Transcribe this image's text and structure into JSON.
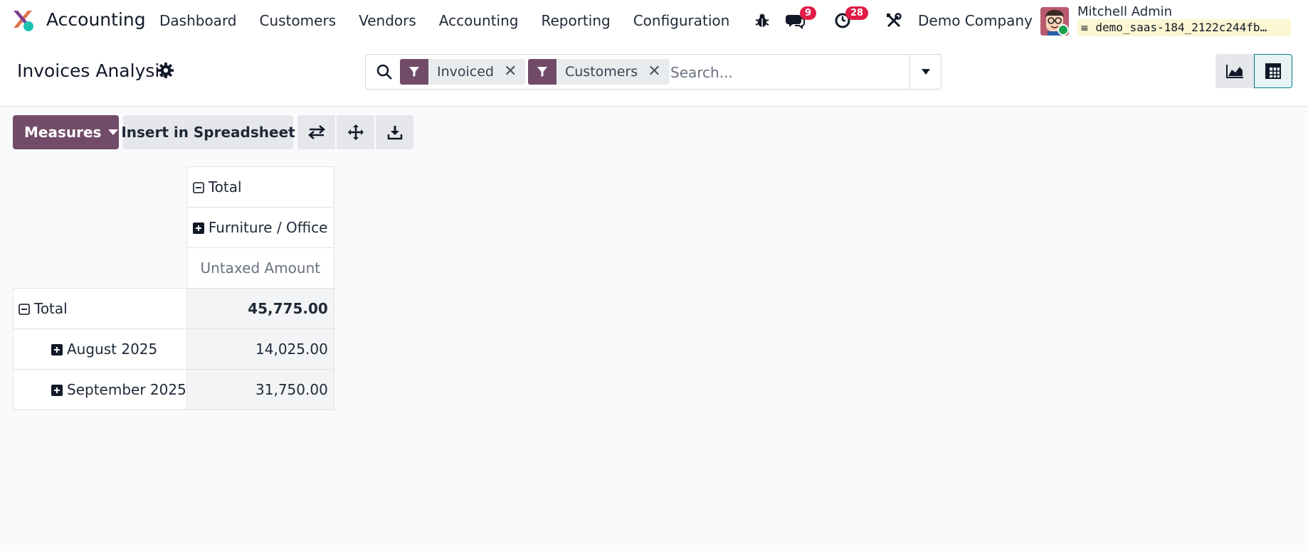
{
  "navbar": {
    "app_name": "Accounting",
    "menu": [
      "Dashboard",
      "Customers",
      "Vendors",
      "Accounting",
      "Reporting",
      "Configuration"
    ],
    "messages_count": "9",
    "activities_count": "28",
    "company": "Demo Company",
    "user_name": "Mitchell Admin",
    "database": "demo_saas-184_2122c244fb…"
  },
  "control_panel": {
    "title": "Invoices Analysis",
    "facets": [
      "Invoiced",
      "Customers"
    ],
    "search_placeholder": "Search...",
    "views": [
      "graph-view",
      "pivot-view"
    ],
    "active_view": "pivot-view"
  },
  "actions": {
    "measures_label": "Measures",
    "insert_label": "Insert in Spreadsheet"
  },
  "pivot": {
    "col_total": "Total",
    "col_group": "Furniture / Office",
    "measure": "Untaxed Amount",
    "row_total": "Total",
    "total_value": "45,775.00",
    "rows": [
      {
        "label": "August 2025",
        "value": "14,025.00"
      },
      {
        "label": "September 2025",
        "value": "31,750.00"
      }
    ]
  },
  "colors": {
    "brand": "#714b67",
    "badge": "#e11d48",
    "active_view_border": "#017e84",
    "status_online": "#16a34a"
  }
}
